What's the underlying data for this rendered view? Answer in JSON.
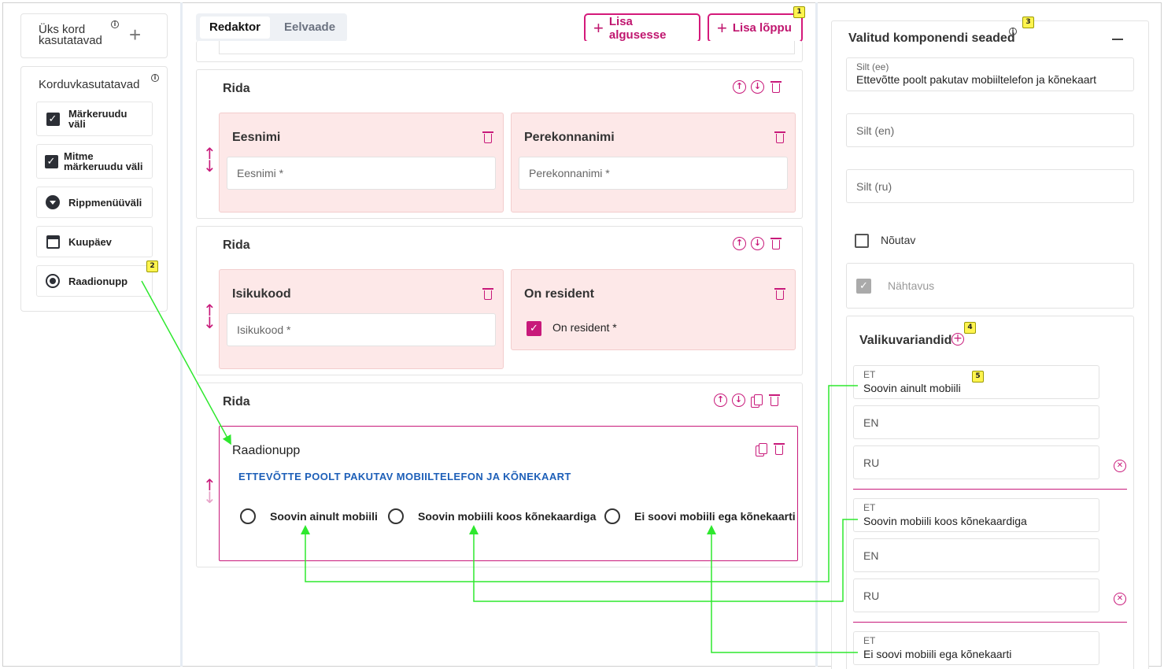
{
  "left": {
    "once": {
      "title": "Üks kord kasutatavad"
    },
    "reusable": {
      "title": "Korduvkasutatavad",
      "items": [
        {
          "label": "Märkeruudu väli",
          "icon": "checkbox-icon"
        },
        {
          "label": "Mitme märkeruudu väli",
          "icon": "checkbox-icon"
        },
        {
          "label": "Rippmenüüväli",
          "icon": "dropdown-icon"
        },
        {
          "label": "Kuupäev",
          "icon": "calendar-icon"
        },
        {
          "label": "Raadionupp",
          "icon": "radio-icon"
        }
      ]
    }
  },
  "middle": {
    "tabs": {
      "editor": "Redaktor",
      "preview": "Eelvaade"
    },
    "add_start": "Lisa algusesse",
    "add_end": "Lisa lõppu",
    "rows": [
      {
        "title": "Rida",
        "fields": [
          {
            "title": "Eesnimi",
            "placeholder": "Eesnimi *"
          },
          {
            "title": "Perekonnanimi",
            "placeholder": "Perekonnanimi *"
          }
        ]
      },
      {
        "title": "Rida",
        "fields": [
          {
            "title": "Isikukood",
            "placeholder": "Isikukood *"
          },
          {
            "title": "On resident",
            "checkbox_label": "On resident *"
          }
        ]
      },
      {
        "title": "Rida",
        "radio": {
          "title": "Raadionupp",
          "label": "ETTEVÕTTE POOLT PAKUTAV MOBIILTELEFON JA KÕNEKAART",
          "options": [
            "Soovin ainult mobiili",
            "Soovin mobiili koos kõnekaardiga",
            "Ei soovi mobiili ega kõnekaarti"
          ]
        }
      }
    ]
  },
  "right": {
    "title": "Valitud komponendi seaded",
    "label_ee": {
      "label": "Silt (ee)",
      "value": "Ettevõtte poolt pakutav mobiiltelefon ja kõnekaart"
    },
    "label_en": "Silt (en)",
    "label_ru": "Silt (ru)",
    "required": "Nõutav",
    "visibility": "Nähtavus",
    "variants": {
      "title": "Valikuvariandid",
      "items": [
        {
          "et_label": "ET",
          "et_value": "Soovin ainult mobiili",
          "en": "EN",
          "ru": "RU"
        },
        {
          "et_label": "ET",
          "et_value": "Soovin mobiili koos kõnekaardiga",
          "en": "EN",
          "ru": "RU"
        },
        {
          "et_label": "ET",
          "et_value": "Ei soovi mobiili ega kõnekaarti"
        }
      ]
    }
  },
  "badges": [
    "1",
    "2",
    "3",
    "4",
    "5"
  ],
  "colors": {
    "accent": "#c8197a",
    "field_bg": "#fde8e8",
    "annotation": "#2ee82e",
    "badge": "#fff44f",
    "link_blue": "#1d5fb8"
  }
}
